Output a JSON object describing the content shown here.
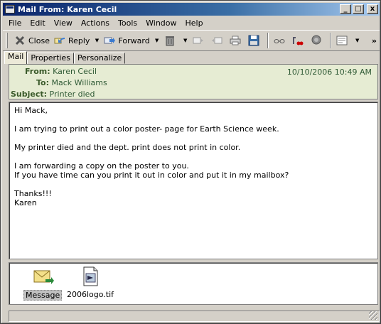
{
  "window": {
    "title": "Mail From: Karen Cecil",
    "minimize": "_",
    "maximize": "□",
    "close": "x"
  },
  "menu": [
    "File",
    "Edit",
    "View",
    "Actions",
    "Tools",
    "Window",
    "Help"
  ],
  "toolbar": {
    "close_label": "Close",
    "reply_label": "Reply",
    "forward_label": "Forward",
    "more": "»"
  },
  "tabs": [
    "Mail",
    "Properties",
    "Personalize"
  ],
  "header": {
    "from_label": "From:",
    "from_value": "Karen Cecil",
    "to_label": "To:",
    "to_value": "Mack Williams",
    "subject_label": "Subject:",
    "subject_value": "Printer died",
    "date": "10/10/2006 10:49 AM"
  },
  "body": {
    "p1": "Hi Mack,",
    "p2": "I am trying to print out a color poster- page for Earth Science week.",
    "p3": "My printer died and the dept. print does not print  in color.",
    "p4a": "I am forwarding a copy on the poster to you.",
    "p4b": "If you have time can you print it out in color and put it in my mailbox?",
    "p5a": "Thanks!!!",
    "p5b": "Karen"
  },
  "attachments": [
    {
      "label": "Message",
      "icon": "message-icon"
    },
    {
      "label": "2006logo.tif",
      "icon": "image-file-icon"
    }
  ],
  "colors": {
    "titlebar": "#0a246a",
    "header_bg": "#e6ecd3",
    "header_label": "#3a5a2a",
    "chrome": "#d4d0c8"
  }
}
